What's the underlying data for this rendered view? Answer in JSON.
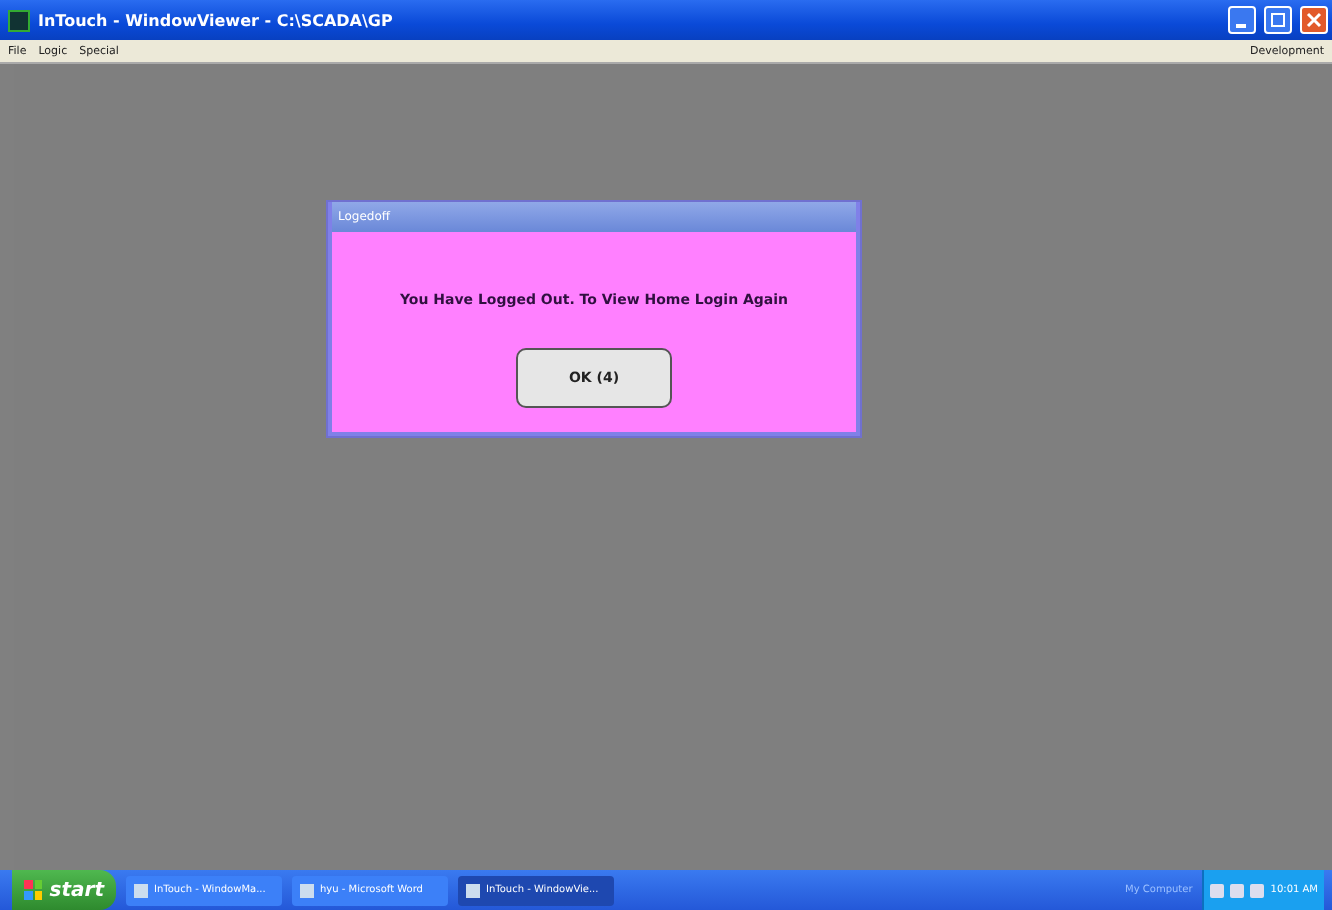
{
  "window": {
    "title": "InTouch - WindowViewer - C:\\SCADA\\GP"
  },
  "menu": [
    "File",
    "Logic",
    "Special"
  ],
  "menu_right": "Development",
  "dialog": {
    "title": "Logedoff",
    "message": "You Have Logged Out. To View Home Login Again",
    "button": "OK (4)"
  },
  "taskbar": {
    "start": "start",
    "tasks": [
      {
        "label": "InTouch - WindowMa...",
        "selected": false
      },
      {
        "label": "hyu - Microsoft Word",
        "selected": false
      },
      {
        "label": "InTouch - WindowVie...",
        "selected": true
      }
    ],
    "toolbar_label": "My Computer",
    "clock": "10:01 AM"
  }
}
